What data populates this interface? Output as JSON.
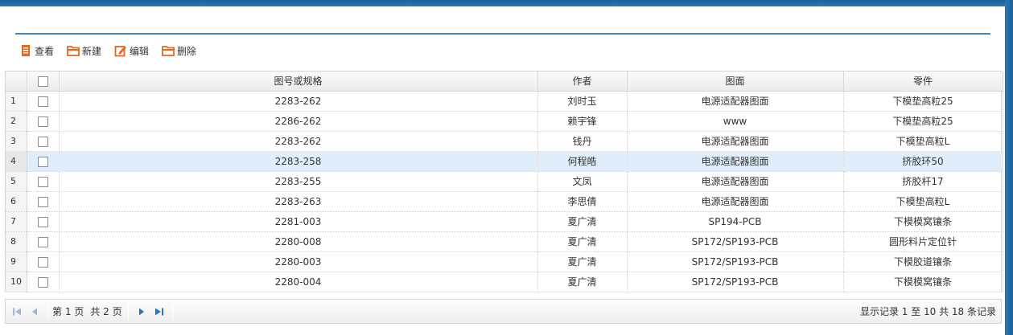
{
  "toolbar": {
    "view_label": "查看",
    "new_label": "新建",
    "edit_label": "编辑",
    "delete_label": "删除"
  },
  "grid": {
    "headers": {
      "spec": "图号或规格",
      "author": "作者",
      "drawing": "图面",
      "part": "零件"
    },
    "selected_row": 3,
    "rows": [
      {
        "n": "1",
        "spec": "2283-262",
        "author": "刘时玉",
        "drawing": "电源适配器图面",
        "part": "下模垫高粒25"
      },
      {
        "n": "2",
        "spec": "2286-262",
        "author": "赖宇锋",
        "drawing": "www",
        "part": "下模垫高粒25"
      },
      {
        "n": "3",
        "spec": "2283-262",
        "author": "钱丹",
        "drawing": "电源适配器图面",
        "part": "下模垫高粒L"
      },
      {
        "n": "4",
        "spec": "2283-258",
        "author": "何程皓",
        "drawing": "电源适配器图面",
        "part": "挤胶环50"
      },
      {
        "n": "5",
        "spec": "2283-255",
        "author": "文凤",
        "drawing": "电源适配器图面",
        "part": "挤胶杆17"
      },
      {
        "n": "6",
        "spec": "2283-263",
        "author": "李思倩",
        "drawing": "电源适配器图面",
        "part": "下模垫高粒L"
      },
      {
        "n": "7",
        "spec": "2281-003",
        "author": "夏广清",
        "drawing": "SP194-PCB",
        "part": "下模模窝镶条"
      },
      {
        "n": "8",
        "spec": "2280-008",
        "author": "夏广清",
        "drawing": "SP172/SP193-PCB",
        "part": "圆形料片定位针"
      },
      {
        "n": "9",
        "spec": "2280-003",
        "author": "夏广清",
        "drawing": "SP172/SP193-PCB",
        "part": "下模胶道镶条"
      },
      {
        "n": "10",
        "spec": "2280-004",
        "author": "夏广清",
        "drawing": "SP172/SP193-PCB",
        "part": "下模模窝镶条"
      }
    ]
  },
  "pager": {
    "page_prefix": "第",
    "page_current": "1",
    "page_suffix": "页",
    "total_pages": "共 2 页",
    "info": "显示记录 1 至 10 共 18 条记录"
  },
  "colors": {
    "accent": "#3b86c4",
    "icon_orange": "#e8661c",
    "pager_blue": "#2a74c7",
    "selected_row": "#e0eefb"
  }
}
